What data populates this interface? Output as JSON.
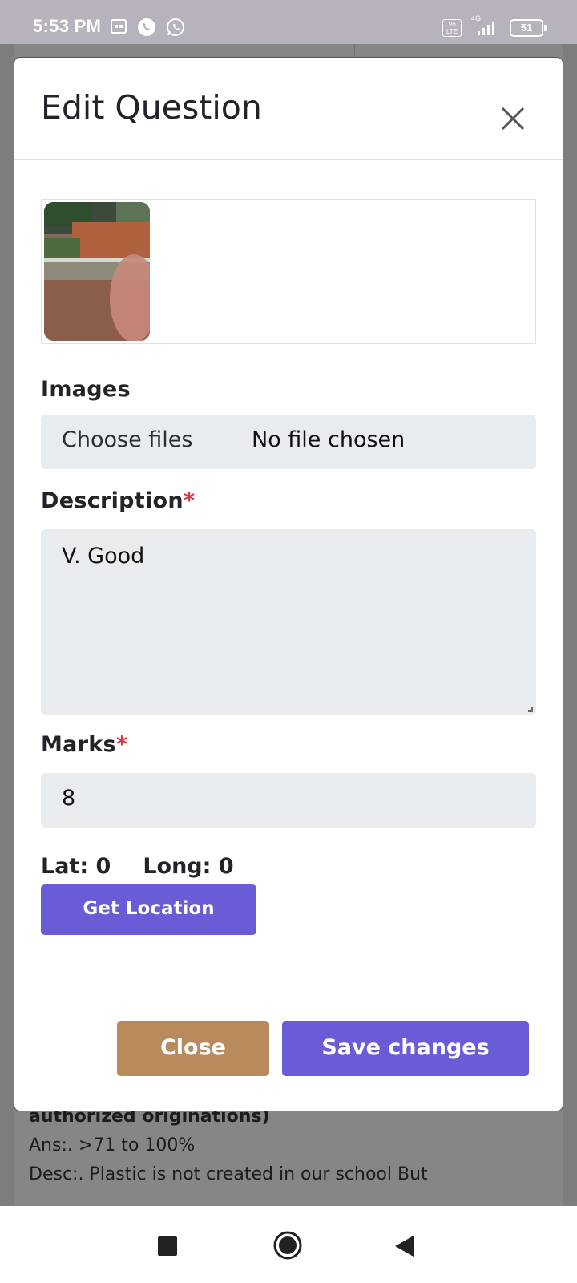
{
  "status_bar": {
    "time": "5:53 PM",
    "left_icons": [
      "screencast-icon",
      "phone-call-icon",
      "whatsapp-icon"
    ],
    "volte": "Vo LTE",
    "network": "4G",
    "battery": "51"
  },
  "modal": {
    "title": "Edit Question",
    "close_icon": "close-icon",
    "images_label": "Images",
    "file_button": "Choose files",
    "file_status": "No file chosen",
    "description_label": "Description",
    "required_marker": "*",
    "description_value": "V. Good",
    "marks_label": "Marks",
    "marks_value": "8",
    "lat": "Lat: 0",
    "long": "Long: 0",
    "get_location": "Get Location",
    "close_button": "Close",
    "save_button": "Save changes"
  },
  "background": {
    "line1": "authorized originations)",
    "line2": "Ans:. >71 to 100%",
    "line3": "Desc:. Plastic is not created in our school But"
  },
  "nav_bar": {
    "icons": [
      "recents-square-icon",
      "home-circle-icon",
      "back-triangle-icon"
    ]
  },
  "colors": {
    "primary": "#6a5bd6",
    "close_button": "#b98a5c",
    "required": "#dc3545",
    "input_bg": "#e9ecef"
  }
}
